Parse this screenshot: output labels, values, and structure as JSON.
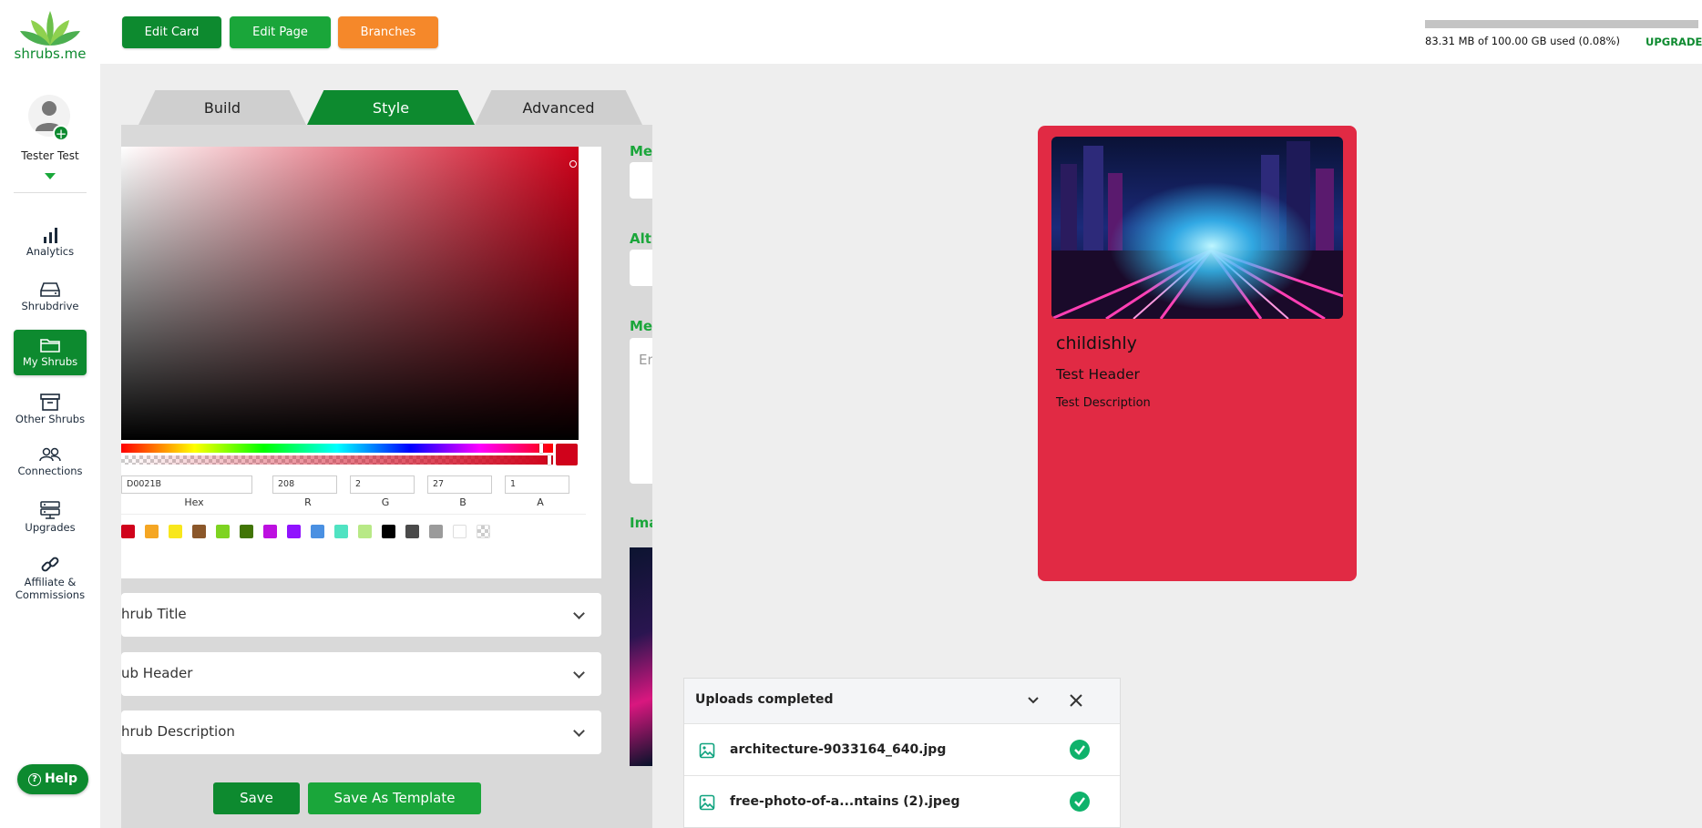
{
  "brand": {
    "logo_text": "shrubs.me"
  },
  "user": {
    "name": "Tester Test"
  },
  "sidebar": {
    "items": [
      {
        "label": "Analytics",
        "icon": "bar-chart-icon"
      },
      {
        "label": "Shrubdrive",
        "icon": "drive-icon"
      },
      {
        "label": "My Shrubs",
        "icon": "folder-icon",
        "active": true
      },
      {
        "label": "Other Shrubs",
        "icon": "archive-icon"
      },
      {
        "label": "Connections",
        "icon": "users-icon"
      },
      {
        "label": "Upgrades",
        "icon": "server-icon"
      },
      {
        "label": "Affiliate & Commissions",
        "icon": "link-icon"
      }
    ],
    "help_label": "Help"
  },
  "topbar": {
    "edit_card": "Edit Card",
    "edit_page": "Edit Page",
    "branches": "Branches",
    "storage_text": "83.31 MB of 100.00 GB used (0.08%)",
    "storage_fraction": 0.0008,
    "upgrade": "UPGRADE"
  },
  "editor": {
    "tabs": [
      {
        "label": "Build"
      },
      {
        "label": "Style",
        "active": true
      },
      {
        "label": "Advanced"
      }
    ],
    "color_picker": {
      "hex": "D0021B",
      "r": "208",
      "g": "2",
      "b": "27",
      "a": "1",
      "labels": {
        "hex": "Hex",
        "r": "R",
        "g": "G",
        "b": "B",
        "a": "A"
      },
      "presets": [
        "#d0021b",
        "#f5a623",
        "#f8e71c",
        "#8b572a",
        "#7ed321",
        "#417505",
        "#bd10e0",
        "#9013fe",
        "#4a90e2",
        "#50e3c2",
        "#b8e986",
        "#000000",
        "#4a4a4a",
        "#9b9b9b",
        "#ffffff",
        "transparent"
      ]
    },
    "accordions": [
      {
        "label": "hrub Title"
      },
      {
        "label": "ub Header"
      },
      {
        "label": "hrub Description"
      }
    ],
    "save": "Save",
    "save_template": "Save As Template",
    "side_fields": {
      "meta_title_label": "Met",
      "alt_label": "Alt",
      "meta_desc_label": "Met",
      "meta_desc_placeholder": "En",
      "image_label": "Ima"
    }
  },
  "preview": {
    "title": "childishly",
    "header": "Test Header",
    "description": "Test Description",
    "card_color": "#e12a44"
  },
  "uploads": {
    "title": "Uploads completed",
    "files": [
      {
        "name": "architecture-9033164_640.jpg",
        "status": "done"
      },
      {
        "name": "free-photo-of-a...ntains (2).jpeg",
        "status": "done"
      }
    ]
  }
}
